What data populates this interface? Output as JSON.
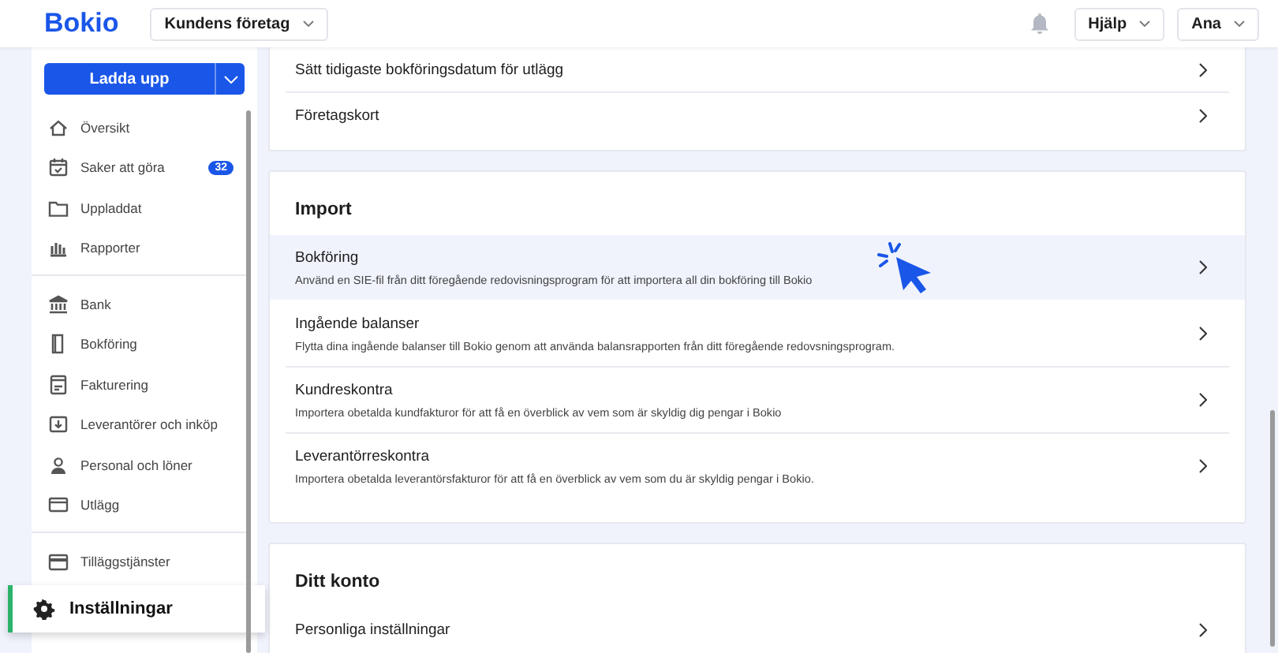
{
  "header": {
    "logo": "Bokio",
    "company": "Kundens företag",
    "help": "Hjälp",
    "user": "Ana"
  },
  "sidebar": {
    "upload_button": "Ladda upp",
    "groups": [
      [
        {
          "label": "Översikt",
          "selected": false
        },
        {
          "label": "Saker att göra",
          "selected": false,
          "badge": "32"
        },
        {
          "label": "Uppladdat",
          "selected": false
        },
        {
          "label": "Rapporter",
          "selected": false
        }
      ],
      [
        {
          "label": "Bank",
          "selected": false
        },
        {
          "label": "Bokföring",
          "selected": false
        },
        {
          "label": "Fakturering",
          "selected": false
        },
        {
          "label": "Leverantörer och inköp",
          "selected": false
        },
        {
          "label": "Personal och löner",
          "selected": false
        },
        {
          "label": "Utlägg",
          "selected": false
        }
      ],
      [
        {
          "label": "Tilläggstjänster",
          "selected": false
        },
        {
          "label": "Inställningar",
          "selected": true
        }
      ]
    ]
  },
  "sections": [
    {
      "rows": [
        {
          "title": "Sätt tidigaste bokföringsdatum för utlägg",
          "highlighted": false
        },
        {
          "title": "Företagskort",
          "highlighted": false
        }
      ]
    },
    {
      "title": "Import",
      "rows": [
        {
          "title": "Bokföring",
          "description": "Använd en SIE-fil från ditt föregående redovisningsprogram för att importera all din bokföring till Bokio",
          "highlighted": true
        },
        {
          "title": "Ingående balanser",
          "description": "Flytta dina ingående balanser till Bokio genom att använda balansrapporten från ditt föregående redovsningsprogram.",
          "highlighted": false
        },
        {
          "title": "Kundreskontra",
          "description": "Importera obetalda kundfakturor för att få en överblick av vem som är skyldig dig pengar i Bokio",
          "highlighted": false
        },
        {
          "title": "Leverantörreskontra",
          "description": "Importera obetalda leverantörsfakturor för att få en överblick av vem som du är skyldig pengar i Bokio.",
          "highlighted": false
        }
      ]
    },
    {
      "title": "Ditt konto",
      "rows": [
        {
          "title": "Personliga inställningar",
          "highlighted": false
        }
      ]
    }
  ]
}
